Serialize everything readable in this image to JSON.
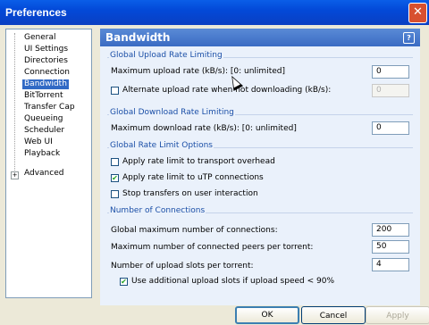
{
  "window": {
    "title": "Preferences",
    "close_label": "✕"
  },
  "tree": {
    "items": [
      {
        "label": "General"
      },
      {
        "label": "UI Settings"
      },
      {
        "label": "Directories"
      },
      {
        "label": "Connection"
      },
      {
        "label": "Bandwidth",
        "selected": true
      },
      {
        "label": "BitTorrent"
      },
      {
        "label": "Transfer Cap"
      },
      {
        "label": "Queueing"
      },
      {
        "label": "Scheduler"
      },
      {
        "label": "Web UI"
      },
      {
        "label": "Playback"
      },
      {
        "label": "Advanced",
        "expandable": true
      }
    ]
  },
  "panel": {
    "title": "Bandwidth",
    "help_label": "?",
    "upload": {
      "group_title": "Global Upload Rate Limiting",
      "max_label": "Maximum upload rate (kB/s): [0: unlimited]",
      "max_value": "0",
      "alt_label": "Alternate upload rate when not downloading (kB/s):",
      "alt_value": "0",
      "alt_checked": false
    },
    "download": {
      "group_title": "Global Download Rate Limiting",
      "max_label": "Maximum download rate (kB/s): [0: unlimited]",
      "max_value": "0"
    },
    "options": {
      "group_title": "Global Rate Limit Options",
      "overhead_label": "Apply rate limit to transport overhead",
      "overhead_checked": false,
      "utp_label": "Apply rate limit to uTP connections",
      "utp_checked": true,
      "stop_label": "Stop transfers on user interaction",
      "stop_checked": false
    },
    "connections": {
      "group_title": "Number of Connections",
      "global_label": "Global maximum number of connections:",
      "global_value": "200",
      "peers_label": "Maximum number of connected peers per torrent:",
      "peers_value": "50",
      "slots_label": "Number of upload slots per torrent:",
      "slots_value": "4",
      "extra_label": "Use additional upload slots if upload speed < 90%",
      "extra_checked": true
    }
  },
  "buttons": {
    "ok": "OK",
    "cancel": "Cancel",
    "apply": "Apply"
  }
}
